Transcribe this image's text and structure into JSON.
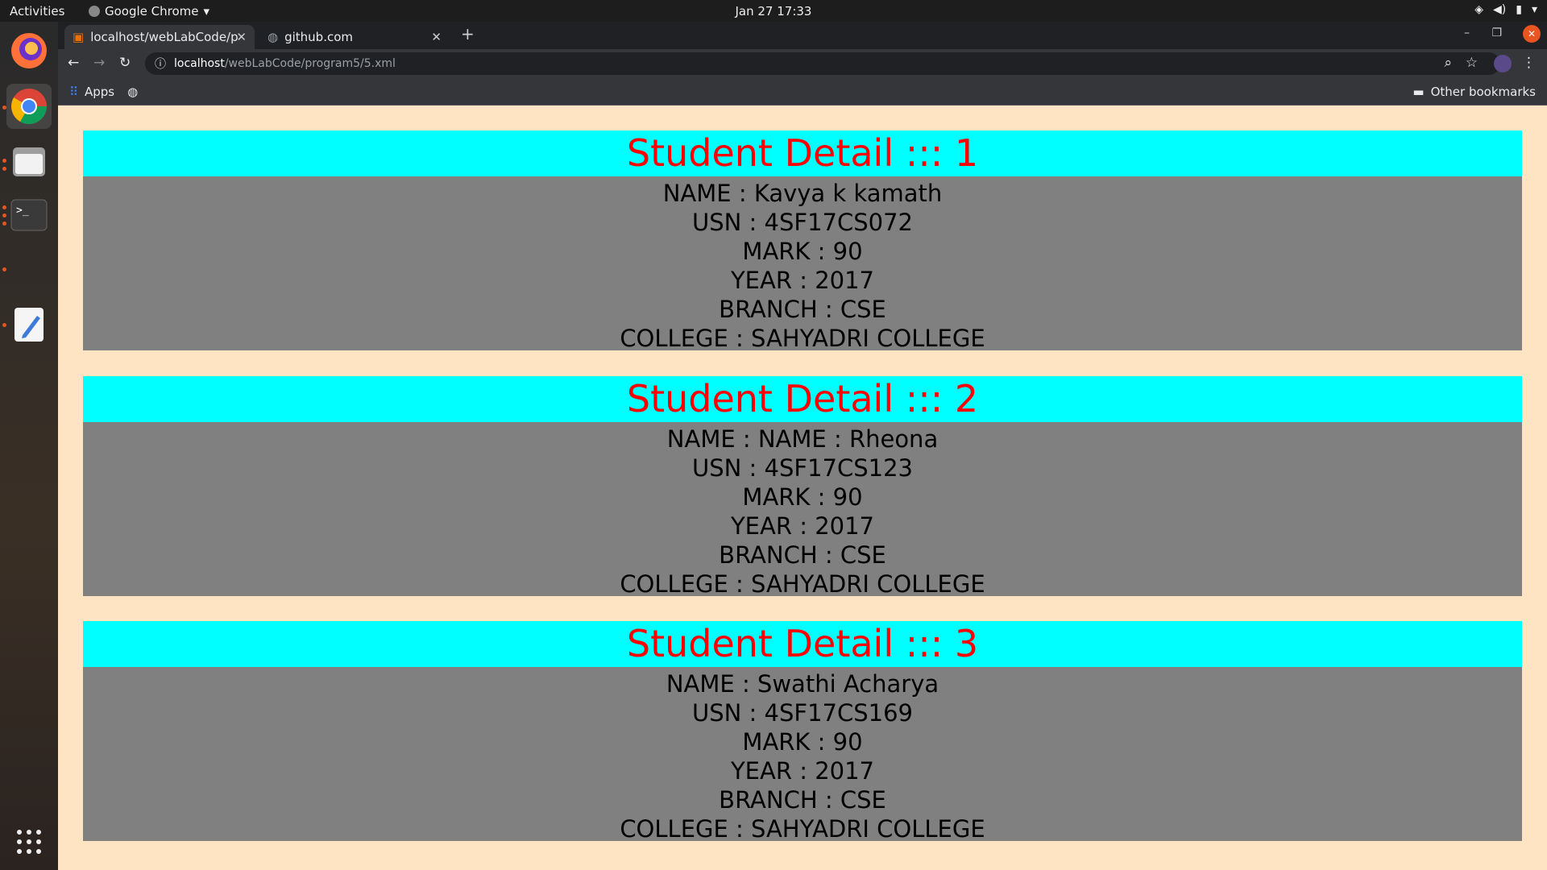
{
  "topbar": {
    "activities": "Activities",
    "app_name": "Google Chrome",
    "clock": "Jan 27  17:33"
  },
  "browser": {
    "tabs": [
      {
        "label": "localhost/webLabCode/p"
      },
      {
        "label": "github.com"
      }
    ],
    "url_host": "localhost",
    "url_path": "/webLabCode/program5/5.xml",
    "bookmarks": {
      "apps": "Apps",
      "other": "Other bookmarks"
    }
  },
  "students": [
    {
      "title": "Student Detail ::: 1",
      "name": "NAME : Kavya k kamath",
      "usn": "USN : 4SF17CS072",
      "mark": "MARK : 90",
      "year": "YEAR : 2017",
      "branch": "BRANCH : CSE",
      "college": "COLLEGE : SAHYADRI COLLEGE"
    },
    {
      "title": "Student Detail ::: 2",
      "name": "NAME : NAME : Rheona",
      "usn": "USN : 4SF17CS123",
      "mark": "MARK : 90",
      "year": "YEAR : 2017",
      "branch": "BRANCH : CSE",
      "college": "COLLEGE : SAHYADRI COLLEGE"
    },
    {
      "title": "Student Detail ::: 3",
      "name": "NAME : Swathi Acharya",
      "usn": "USN : 4SF17CS169",
      "mark": "MARK : 90",
      "year": "YEAR : 2017",
      "branch": "BRANCH : CSE",
      "college": "COLLEGE : SAHYADRI COLLEGE"
    }
  ],
  "colors": {
    "page_bg": "#ffe4c4",
    "title_bg": "#00ffff",
    "title_text": "#ff0000",
    "body_bg": "#808080"
  }
}
